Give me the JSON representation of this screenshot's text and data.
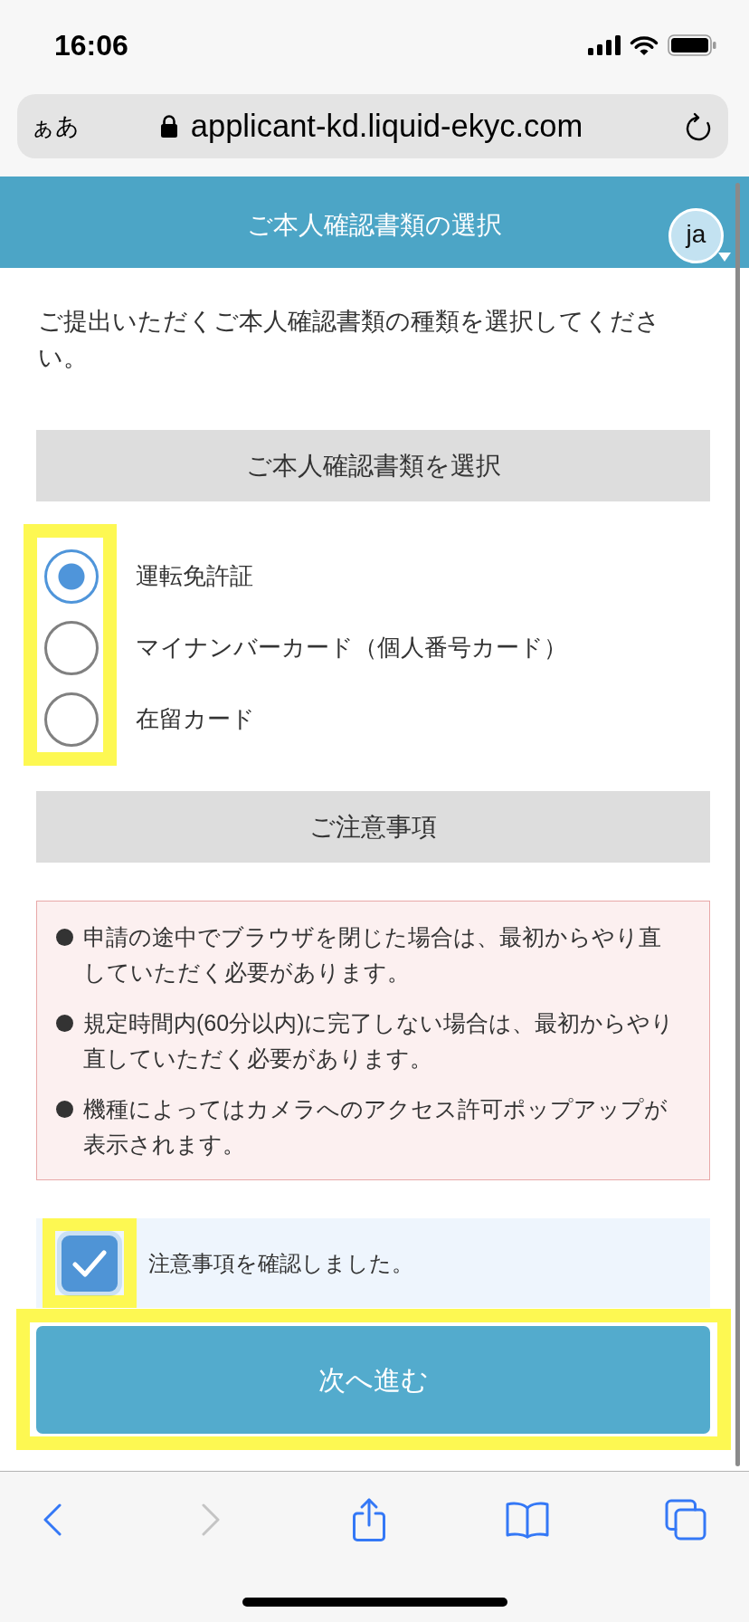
{
  "status_bar": {
    "time": "16:06"
  },
  "address_bar": {
    "text_size_button": "ぁあ",
    "url": "applicant-kd.liquid-ekyc.com"
  },
  "header": {
    "title": "ご本人確認書類の選択",
    "language_button": "ja"
  },
  "intro": "ご提出いただくご本人確認書類の種類を選択してください。",
  "document_section": {
    "heading": "ご本人確認書類を選択",
    "highlighted": true,
    "options": [
      {
        "label": "運転免許証",
        "selected": true
      },
      {
        "label": "マイナンバーカード（個人番号カード）",
        "selected": false
      },
      {
        "label": "在留カード",
        "selected": false
      }
    ]
  },
  "notes_section": {
    "heading": "ご注意事項",
    "notes": [
      "申請の途中でブラウザを閉じた場合は、最初からやり直していただく必要があります。",
      "規定時間内(60分以内)に完了しない場合は、最初からやり直していただく必要があります。",
      "機種によってはカメラへのアクセス許可ポップアップが表示されます。"
    ]
  },
  "agree_checkbox": {
    "label": "注意事項を確認しました。",
    "checked": true,
    "highlighted": true
  },
  "next_button": {
    "label": "次へ進む",
    "highlighted": true
  },
  "toolbar": {
    "items": [
      {
        "kind": "back",
        "disabled": false
      },
      {
        "kind": "forward",
        "disabled": true
      },
      {
        "kind": "share",
        "disabled": false
      },
      {
        "kind": "bookmarks",
        "disabled": false
      },
      {
        "kind": "tabs",
        "disabled": false
      }
    ]
  }
}
